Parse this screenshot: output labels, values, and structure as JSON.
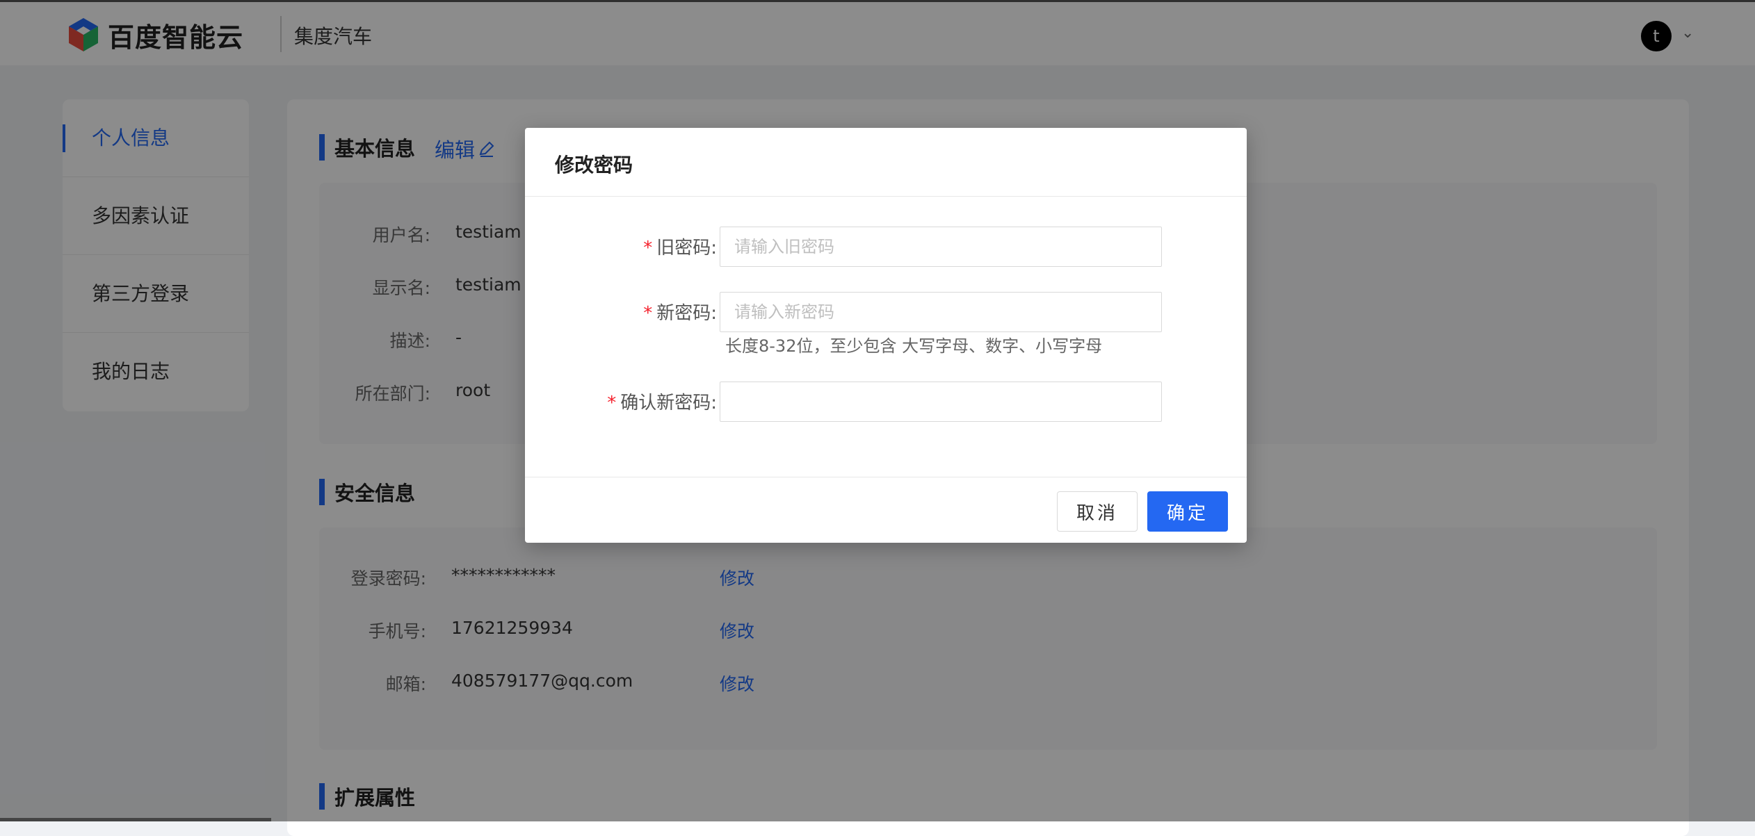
{
  "header": {
    "logo_text": "百度智能云",
    "company": "集度汽车",
    "avatar_initial": "t"
  },
  "sidebar": {
    "items": [
      {
        "label": "个人信息",
        "active": true
      },
      {
        "label": "多因素认证",
        "active": false
      },
      {
        "label": "第三方登录",
        "active": false
      },
      {
        "label": "我的日志",
        "active": false
      }
    ]
  },
  "basic_info": {
    "title": "基本信息",
    "edit_label": "编辑",
    "fields": [
      {
        "label": "用户名:",
        "value": "testiam"
      },
      {
        "label": "显示名:",
        "value": "testiam"
      },
      {
        "label": "描述:",
        "value": "-"
      },
      {
        "label": "所在部门:",
        "value": "root"
      }
    ]
  },
  "security_info": {
    "title": "安全信息",
    "fields": [
      {
        "label": "登录密码:",
        "value": "************",
        "action": "修改"
      },
      {
        "label": "手机号:",
        "value": "17621259934",
        "action": "修改"
      },
      {
        "label": "邮箱:",
        "value": "408579177@qq.com",
        "action": "修改"
      }
    ]
  },
  "extended_info": {
    "title": "扩展属性"
  },
  "modal": {
    "title": "修改密码",
    "old_password": {
      "required_mark": "*",
      "label": "旧密码:",
      "placeholder": "请输入旧密码",
      "value": ""
    },
    "new_password": {
      "required_mark": "*",
      "label": "新密码:",
      "placeholder": "请输入新密码",
      "value": ""
    },
    "hint": "长度8-32位，至少包含 大写字母、数字、小写字母",
    "confirm_password": {
      "required_mark": "*",
      "label": "确认新密码:",
      "placeholder": "",
      "value": ""
    },
    "cancel_label": "取消",
    "ok_label": "确定"
  },
  "colors": {
    "accent": "#2468f2",
    "required": "#f5222d",
    "mask": "rgba(0,0,0,0.45)"
  }
}
